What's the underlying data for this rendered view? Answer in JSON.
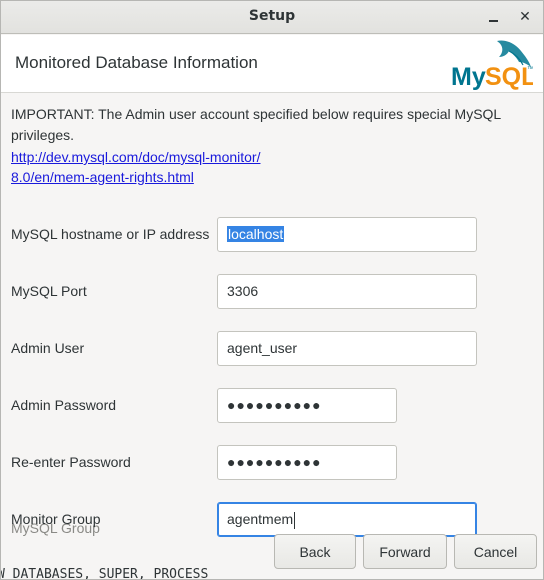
{
  "window": {
    "title": "Setup",
    "minimize_icon": "minimize-icon",
    "close_glyph": "✕"
  },
  "header": {
    "title": "Monitored Database Information",
    "logo_text": "MySQL",
    "logo_tm": "™"
  },
  "notice": {
    "text": "IMPORTANT: The Admin user account specified below requires special MySQL privileges.",
    "link_line1": "http://dev.mysql.com/doc/mysql-monitor/",
    "link_line2": "8.0/en/mem-agent-rights.html"
  },
  "form": {
    "hostname_label": "MySQL hostname or IP address",
    "hostname_value": "localhost",
    "port_label": "MySQL Port",
    "port_value": "3306",
    "admin_user_label": "Admin User",
    "admin_user_value": "agent_user",
    "admin_password_label": "Admin Password",
    "admin_password_value": "●●●●●●●●●●",
    "reenter_password_label": "Re-enter Password",
    "reenter_password_value": "●●●●●●●●●●",
    "monitor_group_label": "Monitor Group",
    "monitor_group_value": "agentmem"
  },
  "background_fragments": {
    "overlapping_label": "MySQL Group",
    "console_text": "W DATABASES, SUPER, PROCESS"
  },
  "buttons": {
    "back": "Back",
    "forward": "Forward",
    "cancel": "Cancel"
  },
  "colors": {
    "accent": "#3584e4",
    "link": "#1a1adc",
    "mysql_blue": "#00758f",
    "mysql_orange": "#f29111"
  }
}
